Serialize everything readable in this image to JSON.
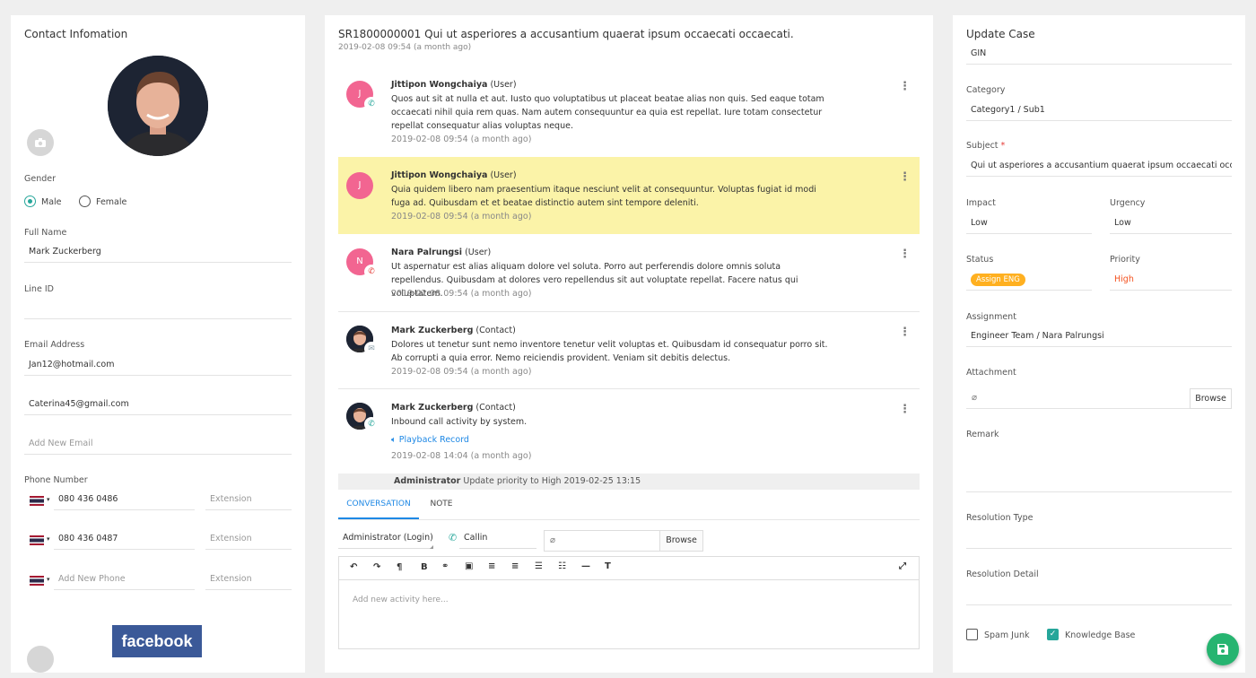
{
  "contact": {
    "title": "Contact Infomation",
    "gender_label": "Gender",
    "gender_male": "Male",
    "gender_female": "Female",
    "fullname_label": "Full Name",
    "fullname_value": "Mark Zuckerberg",
    "lineid_label": "Line ID",
    "email_label": "Email Address",
    "emails": [
      "Jan12@hotmail.com",
      "Caterina45@gmail.com"
    ],
    "email_add_placeholder": "Add New Email",
    "phone_label": "Phone Number",
    "phones": [
      "080 436 0486",
      "080 436 0487"
    ],
    "phone_add_placeholder": "Add New Phone",
    "extension_placeholder": "Extension",
    "facebook_text": "facebook"
  },
  "case": {
    "title": "SR1800000001 Qui ut asperiores a accusantium quaerat ipsum occaecati occaecati.",
    "created": "2019-02-08 09:54 (a month ago)"
  },
  "activities": [
    {
      "initial": "J",
      "name": "Jittipon Wongchaiya",
      "role": "(User)",
      "body": "Quos aut sit at nulla et aut. Iusto quo voluptatibus ut placeat beatae alias non quis. Sed eaque totam occaecati nihil quia rem quas. Nam autem consequuntur ea quia est repellat. Iure totam consectetur repellat consequatur alias voluptas neque.",
      "time": "2019-02-08 09:54 (a month ago)",
      "channel": "phone-icon"
    },
    {
      "initial": "J",
      "name": "Jittipon Wongchaiya",
      "role": "(User)",
      "body": "Quia quidem libero nam praesentium itaque nesciunt velit at consequuntur. Voluptas fugiat id modi fuga ad. Quibusdam et et beatae distinctio autem sint tempore deleniti.",
      "time": "2019-02-08 09:54 (a month ago)",
      "channel": ""
    },
    {
      "initial": "N",
      "name": "Nara Palrungsi",
      "role": "(User)",
      "body": "Ut aspernatur est alias aliquam dolore vel soluta. Porro aut perferendis dolore omnis soluta repellendus. Quibusdam at dolores vero repellendus sit aut voluptate repellat. Facere natus qui voluptatem.",
      "time": "2019-02-08 09:54 (a month ago)",
      "channel": "phone-out-icon"
    },
    {
      "initial": "",
      "name": "Mark Zuckerberg",
      "role": "(Contact)",
      "body": "Dolores ut tenetur sunt nemo inventore tenetur velit voluptas et. Quibusdam id consequatur porro sit. Ab corrupti a quia error. Nemo reiciendis provident. Veniam sit debitis delectus.",
      "time": "2019-02-08 09:54 (a month ago)",
      "channel": "email-icon"
    },
    {
      "initial": "",
      "name": "Mark Zuckerberg",
      "role": "(Contact)",
      "body": "Inbound call activity by system.",
      "playback": "Playback Record",
      "time": "2019-02-08 14:04 (a month ago)",
      "channel": "phone-in-icon"
    }
  ],
  "system_note": {
    "actor": "Administrator",
    "text": "Update priority to High 2019-02-25 13:15"
  },
  "composer": {
    "tabs": [
      "CONVERSATION",
      "NOTE"
    ],
    "sender": "Administrator (Login)",
    "channel": "Callin",
    "browse": "Browse",
    "placeholder": "Add new activity here..."
  },
  "update": {
    "title": "Update Case",
    "top_value": "GIN",
    "category_label": "Category",
    "category_value": "Category1 / Sub1",
    "subject_label": "Subject",
    "subject_required": "*",
    "subject_value": "Qui ut asperiores a accusantium quaerat ipsum occaecati occaecati.",
    "impact_label": "Impact",
    "impact_value": "Low",
    "urgency_label": "Urgency",
    "urgency_value": "Low",
    "status_label": "Status",
    "status_value": "Assign ENG",
    "priority_label": "Priority",
    "priority_value": "High",
    "assignment_label": "Assignment",
    "assignment_value": "Engineer Team / Nara Palrungsi",
    "attachment_label": "Attachment",
    "browse": "Browse",
    "remark_label": "Remark",
    "restype_label": "Resolution Type",
    "resdetail_label": "Resolution Detail",
    "spam_label": "Spam Junk",
    "kb_label": "Knowledge Base",
    "colors": {
      "accent": "#26a69a",
      "pill": "#ffb020",
      "priority": "#f4511e",
      "save": "#26b470",
      "highlight": "#fbf3a8"
    }
  }
}
